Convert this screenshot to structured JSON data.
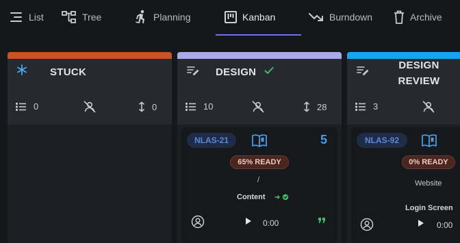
{
  "tabs": [
    {
      "label": "List",
      "icon": "list-icon"
    },
    {
      "label": "Tree",
      "icon": "tree-icon"
    },
    {
      "label": "Planning",
      "icon": "running-person-icon"
    },
    {
      "label": "Kanban",
      "icon": "kanban-icon",
      "active": true
    },
    {
      "label": "Burndown",
      "icon": "trend-down-icon"
    },
    {
      "label": "Archive",
      "icon": "trash-icon"
    }
  ],
  "columns": [
    {
      "title": "STUCK",
      "color": "#c85426",
      "icon": "snowflake-icon",
      "item_count": "0",
      "unassigned_icon": "person-off-icon",
      "height_value": "0"
    },
    {
      "title": "DESIGN",
      "color": "#a9a9ec",
      "icon": "edit-list-icon",
      "done_icon": "check-icon",
      "item_count": "10",
      "height_value": "28",
      "card": {
        "id": "NLAS-21",
        "points": "5",
        "ready": "65% READY",
        "separator": "/",
        "category": "Content",
        "timer": "0:00"
      }
    },
    {
      "title_line1": "DESIGN",
      "title_line2": "REVIEW",
      "color": "#12a6f0",
      "icon": "edit-list-icon",
      "item_count": "3",
      "card": {
        "id": "NLAS-92",
        "ready": "0% READY",
        "project": "Website",
        "category": "Login Screen",
        "timer": "0:00"
      }
    }
  ]
}
